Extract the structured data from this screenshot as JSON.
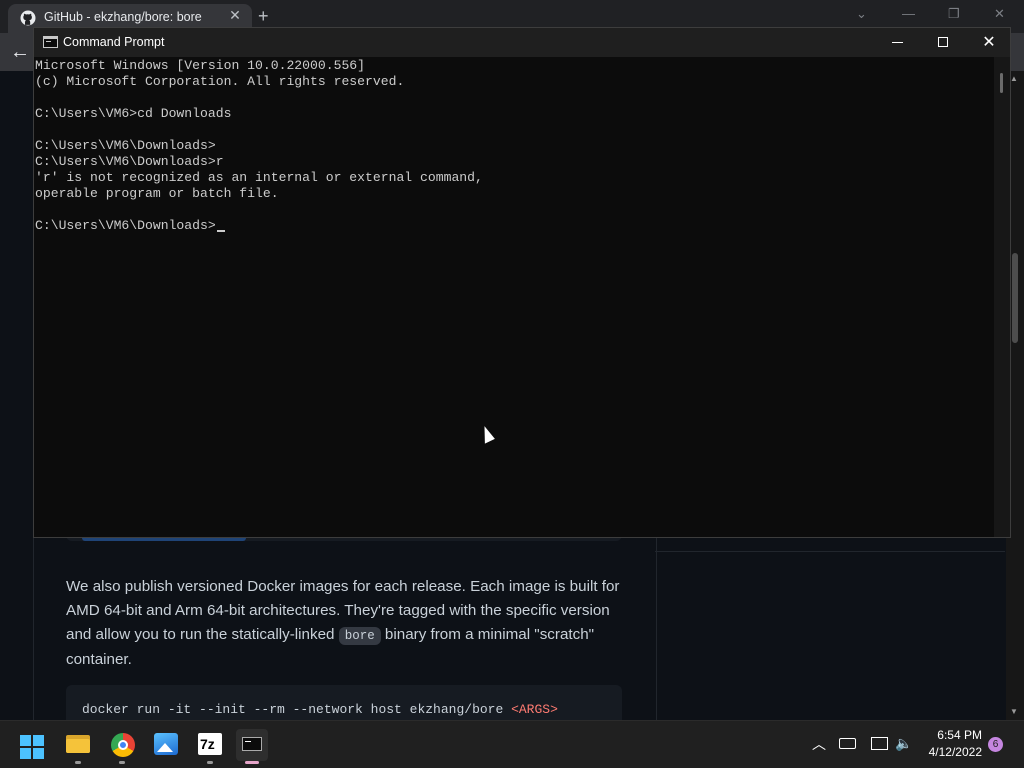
{
  "browser": {
    "tab_title": "GitHub - ekzhang/bore: bore",
    "tab_close": "✕",
    "new_tab": "+",
    "back": "←"
  },
  "page": {
    "paragraph_before": "We also publish versioned Docker images for each release. Each image is built for AMD 64-bit and Arm 64-bit architectures. They're tagged with the specific version and allow you to run the statically-linked ",
    "paragraph_code": "bore",
    "paragraph_after": " binary from a minimal \"scratch\" container.",
    "code_command": "docker run -it --init --rm --network host ekzhang/bore ",
    "code_arg": "<ARGS>"
  },
  "cmd": {
    "title": "Command Prompt",
    "lines": [
      "Microsoft Windows [Version 10.0.22000.556]",
      "(c) Microsoft Corporation. All rights reserved.",
      "",
      "C:\\Users\\VM6>cd Downloads",
      "",
      "C:\\Users\\VM6\\Downloads>",
      "C:\\Users\\VM6\\Downloads>r",
      "'r' is not recognized as an internal or external command,",
      "operable program or batch file.",
      "",
      "C:\\Users\\VM6\\Downloads>"
    ]
  },
  "taskbar": {
    "apps": [
      "windows-start",
      "file-explorer",
      "chrome",
      "photos",
      "7-zip",
      "command-prompt"
    ],
    "sevenzip_label": "7z",
    "time": "6:54 PM",
    "date": "4/12/2022",
    "notification_count": "6"
  },
  "colors": {
    "terminal_bg": "#0c0c0c",
    "terminal_text": "#cccccc",
    "page_bg": "#0d1117",
    "taskbar_bg": "#202020",
    "start_blue": "#4cc2ff"
  }
}
